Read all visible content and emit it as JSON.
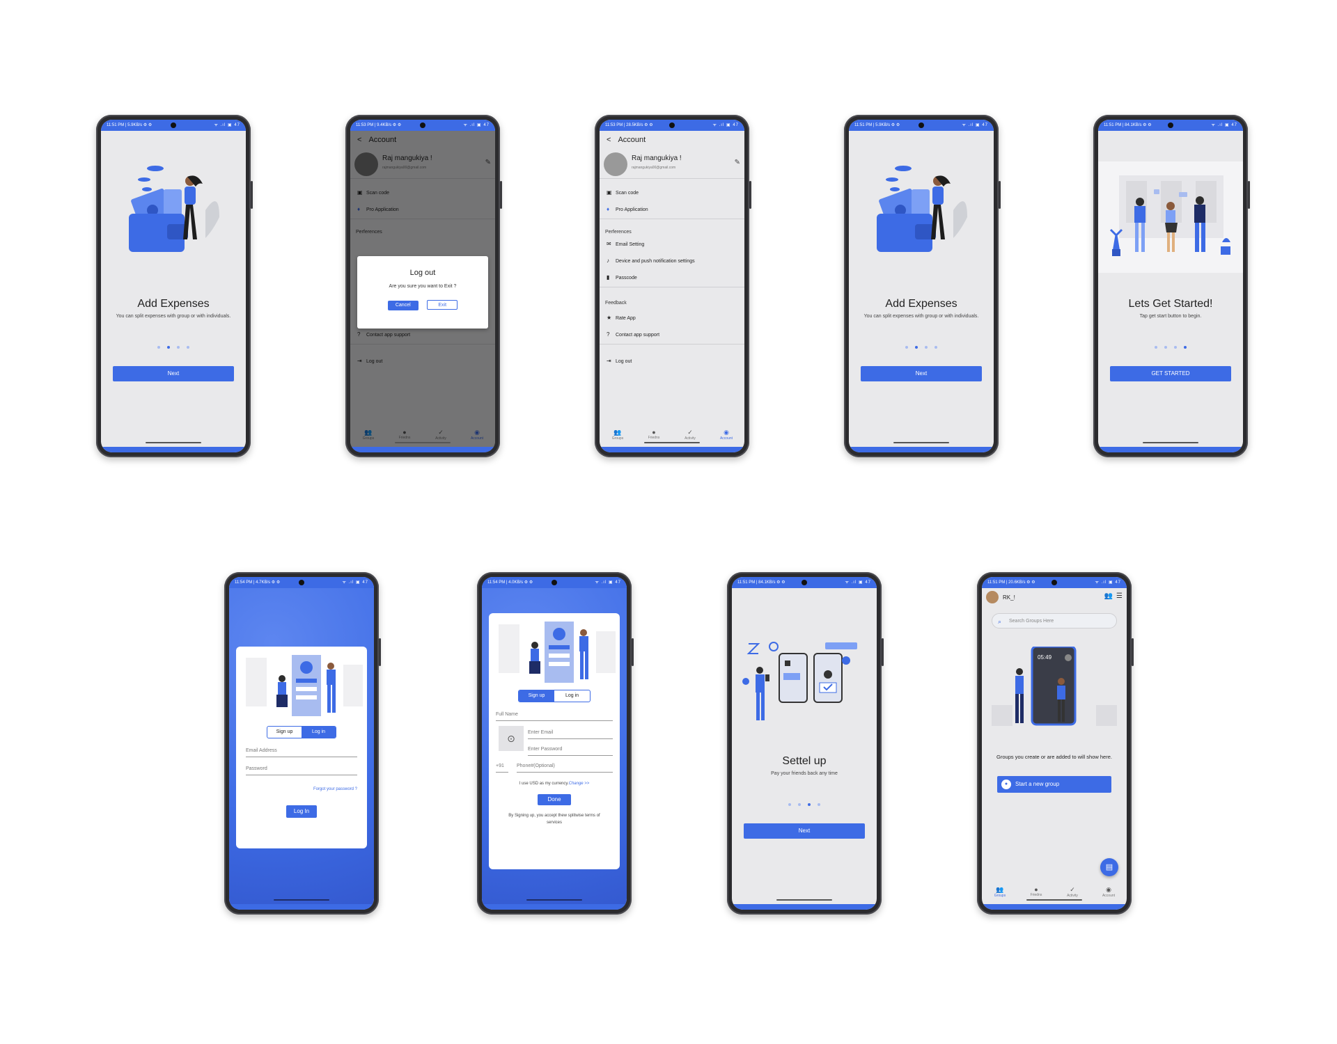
{
  "status": {
    "p1": "11:51 PM | 5.9KB/s ⚙ ⚙",
    "p2": "11:53 PM | 9.4KB/s ⚙ ⚙",
    "p3": "11:53 PM | 28.5KB/s ⚙ ⚙",
    "p4": "11:51 PM | 5.9KB/s ⚙ ⚙",
    "p5": "11:51 PM | 84.1KB/s ⚙ ⚙",
    "p6": "11:54 PM | 4.7KB/s ⚙ ⚙",
    "p7": "11:54 PM | 4.0KB/s ⚙ ⚙",
    "p8": "11:51 PM | 84.1KB/s ⚙ ⚙",
    "p9": "11:51 PM | 20.6KB/s ⚙ ⚙",
    "icons": "ᯤ .ıl ▣ 47"
  },
  "onboarding_expenses": {
    "title": "Add Expenses",
    "subtitle": "You can split expenses with group or with individuals.",
    "next": "Next"
  },
  "onboarding_start": {
    "title": "Lets Get Started!",
    "subtitle": "Tap get start button to begin.",
    "button": "GET STARTED"
  },
  "onboarding_settle": {
    "title": "Settel up",
    "subtitle": "Pay your friends back any time",
    "next": "Next"
  },
  "account": {
    "header": "Account",
    "name": "Raj mangukiya !",
    "email": "rajmangukiya00@gmail.com",
    "scan_code": "Scan code",
    "pro_app": "Pro Application",
    "preferences": "Perferences",
    "email_setting": "Email Setting",
    "device_push": "Device and push notification settings",
    "passcode": "Passcode",
    "feedback": "Feedback",
    "rate_app": "Rate App",
    "contact": "Contact app support",
    "logout": "Log out"
  },
  "logout_dialog": {
    "title": "Log out",
    "message": "Are you sure you want to Exit ?",
    "cancel": "Cancel",
    "exit": "Exit"
  },
  "tabs": {
    "groups": "Groups",
    "friends": "Friedns",
    "activity": "Activity",
    "account": "Account"
  },
  "login": {
    "signup_tab": "Sign up",
    "login_tab": "Log in",
    "email": "Email Address",
    "password": "Password",
    "forgot": "Forgot your password ?",
    "button": "Log In"
  },
  "signup": {
    "signup_tab": "Sign up",
    "login_tab": "Log in",
    "full_name": "Full Name",
    "email": "Enter Email",
    "password": "Enter Password",
    "country_code": "+91",
    "phone": "Phone#(Optional)",
    "currency": "I use USD as my currency.",
    "change": "Change >>",
    "done": "Done",
    "terms": "By Signing up, you accept thew splitwise terms of services"
  },
  "groups": {
    "user": "RK_!",
    "search_placeholder": "Search Groups Here",
    "empty_text": "Groups you create or are added to will show here.",
    "start_group": "Start a new group",
    "phone_time": "05:49"
  },
  "colors": {
    "accent": "#3d6be5",
    "screen_bg": "#e9e9eb"
  }
}
